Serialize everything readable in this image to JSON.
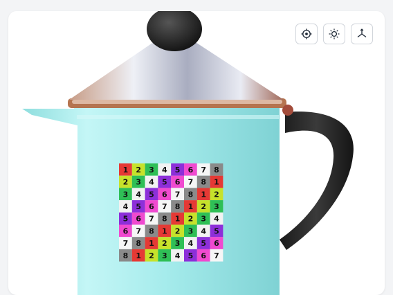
{
  "toolbar": {
    "buttons": [
      {
        "name": "recenter-button",
        "icon": "crosshair-icon"
      },
      {
        "name": "lighting-button",
        "icon": "sun-icon"
      },
      {
        "name": "axes-button",
        "icon": "axes-3d-icon"
      }
    ]
  },
  "texture_grid": {
    "rows": [
      [
        "1",
        "2",
        "3",
        "4",
        "5",
        "6",
        "7",
        "8"
      ],
      [
        "2",
        "3",
        "4",
        "5",
        "6",
        "7",
        "8",
        "1"
      ],
      [
        "3",
        "4",
        "5",
        "6",
        "7",
        "8",
        "1",
        "2"
      ],
      [
        "4",
        "5",
        "6",
        "7",
        "8",
        "1",
        "2",
        "3"
      ],
      [
        "5",
        "6",
        "7",
        "8",
        "1",
        "2",
        "3",
        "4"
      ],
      [
        "6",
        "7",
        "8",
        "1",
        "2",
        "3",
        "4",
        "5"
      ],
      [
        "7",
        "8",
        "1",
        "2",
        "3",
        "4",
        "5",
        "6"
      ],
      [
        "8",
        "1",
        "2",
        "3",
        "4",
        "5",
        "6",
        "7"
      ]
    ],
    "colors": {
      "1": "#e53935",
      "2": "#c6e22b",
      "3": "#2fbf56",
      "4": "#f2f2f2",
      "5": "#8d2fd9",
      "6": "#f04ad0",
      "7": "#f6f6f6",
      "8": "#8a8a8a"
    }
  },
  "colors": {
    "body": "#a7ecec",
    "handle": "#2a2a2a",
    "lid": "#c9ccd6",
    "knob": "#222222",
    "rim": "#b5744f"
  }
}
